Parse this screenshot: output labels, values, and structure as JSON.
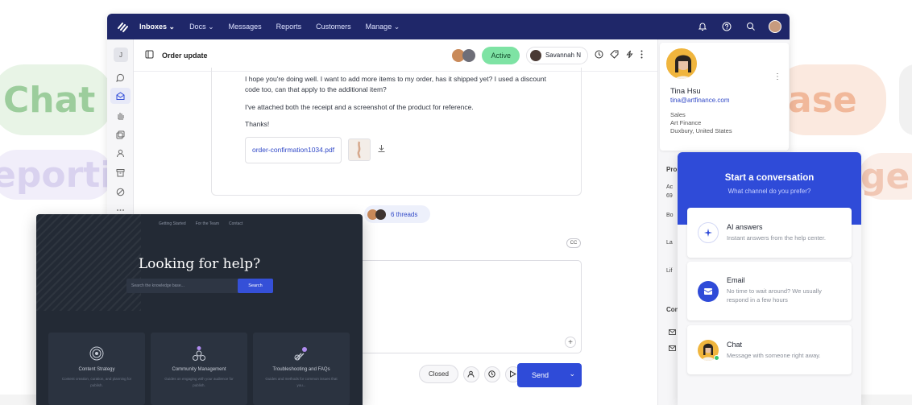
{
  "background": {
    "pill_chat": "Chat",
    "pill_reporting": "eporti",
    "pill_base": "ase",
    "pill_management": "gen"
  },
  "nav": {
    "items": [
      {
        "label": "Inboxes ⌄",
        "active": true
      },
      {
        "label": "Docs ⌄",
        "active": false
      },
      {
        "label": "Messages",
        "active": false
      },
      {
        "label": "Reports",
        "active": false
      },
      {
        "label": "Customers",
        "active": false
      },
      {
        "label": "Manage ⌄",
        "active": false
      }
    ],
    "icons": [
      "bell-icon",
      "help-icon",
      "search-icon",
      "user-avatar"
    ]
  },
  "rail": {
    "initial": "J"
  },
  "conversation": {
    "title": "Order update",
    "status": "Active",
    "assignee": "Savannah N",
    "message": {
      "p1": "I hope you're doing well. I want to add more items to my order, has it shipped yet? I used a discount code too, can that apply to the additional item?",
      "p2": "I've attached both the receipt and a screenshot of the product for reference.",
      "p3": "Thanks!",
      "attachment": "order-confirmation1034.pdf"
    },
    "threads_label": "6 threads",
    "cc_label": "CC",
    "closed_label": "Closed",
    "send_label": "Send",
    "send_caret": "⌄"
  },
  "customer": {
    "name": "Tina Hsu",
    "email": "tina@artfinance.com",
    "role": "Sales",
    "company": "Art Finance",
    "location": "Duxbury, United States",
    "section_prop": "Prop",
    "row_ac": "Ac",
    "row_69": "69",
    "row_bo": "Bo",
    "row_la": "La",
    "row_lif": "Lif",
    "section_con": "Con"
  },
  "widget": {
    "title": "Start a conversation",
    "subtitle": "What channel do you prefer?",
    "options": [
      {
        "title": "AI answers",
        "desc": "Instant answers from the help center."
      },
      {
        "title": "Email",
        "desc": "No time to wait around? We usually respond in a few hours"
      },
      {
        "title": "Chat",
        "desc": "Message with someone right away."
      }
    ]
  },
  "kb": {
    "nav": [
      "Getting Started",
      "For the Team",
      "Contact"
    ],
    "title": "Looking for help?",
    "search_placeholder": "Search the knowledge base...",
    "search_button": "Search",
    "cards": [
      {
        "title": "Content Strategy",
        "desc": "Content creation, curation, and planning for publish."
      },
      {
        "title": "Community Management",
        "desc": "Guides on engaging with your audience for publish."
      },
      {
        "title": "Troubleshooting and FAQs",
        "desc": "Guides and methods for common issues that you..."
      }
    ]
  },
  "colors": {
    "nav_bg": "#1f2769",
    "accent": "#2f4bd8",
    "status_active": "#7ee3a4",
    "kb_bg": "#232a35"
  }
}
